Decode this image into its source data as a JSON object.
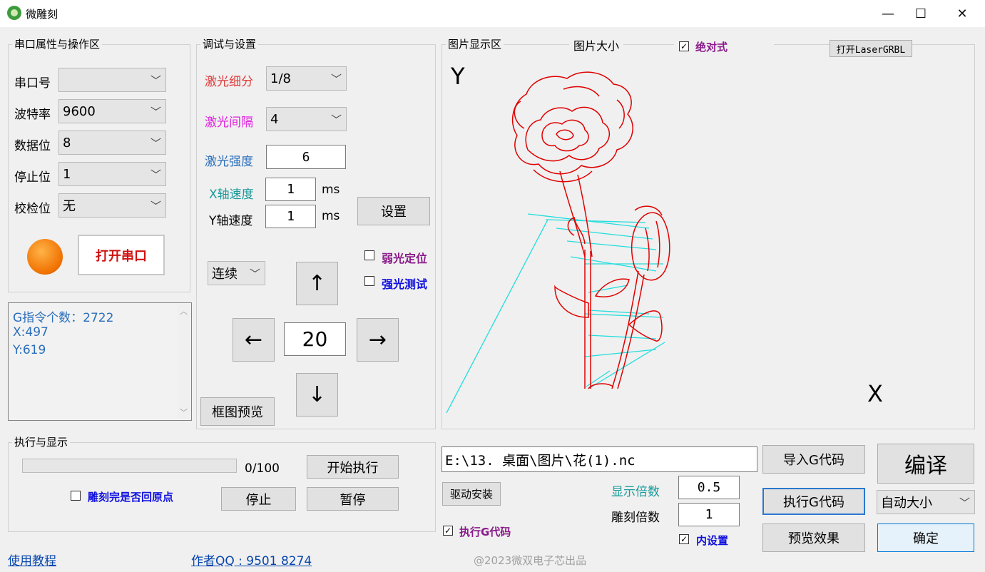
{
  "window": {
    "title": "微雕刻",
    "min": "—",
    "max": "☐",
    "close": "✕"
  },
  "serial": {
    "group": "串口属性与操作区",
    "port_label": "串口号",
    "port_value": "",
    "baud_label": "波特率",
    "baud_value": "9600",
    "data_label": "数据位",
    "data_value": "8",
    "stop_label": "停止位",
    "stop_value": "1",
    "parity_label": "校检位",
    "parity_value": "无",
    "open_button": "打开串口"
  },
  "info": {
    "line1": "G指令个数：2722",
    "line2": "X:497",
    "line3": "Y:619"
  },
  "debug": {
    "group": "调试与设置",
    "subdiv_label": "激光细分",
    "subdiv_value": "1/8",
    "interval_label": "激光间隔",
    "interval_value": "4",
    "power_label": "激光强度",
    "power_value": "6",
    "xspeed_label": "X轴速度",
    "xspeed_value": "1",
    "xspeed_unit": "ms",
    "yspeed_label": "Y轴速度",
    "yspeed_value": "1",
    "yspeed_unit": "ms",
    "set_button": "设置",
    "weak_label": "弱光定位",
    "strong_label": "强光测试",
    "mode_value": "连续",
    "step_value": "20",
    "up": "↑",
    "down": "↓",
    "left": "←",
    "right": "→",
    "frame_button": "框图预览"
  },
  "image": {
    "group": "图片显示区",
    "size_label": "图片大小",
    "absolute_label": "绝对式",
    "absolute_checked": "✓",
    "laser_button": "打开LaserGRBL",
    "y_axis": "Y",
    "x_axis": "X"
  },
  "exec": {
    "group": "执行与显示",
    "progress_text": "0/100",
    "progress": 0,
    "start_button": "开始执行",
    "stop_button": "停止",
    "pause_button": "暂停",
    "home_label": "雕刻完是否回原点"
  },
  "bottom": {
    "path_value": "E:\\13. 桌面\\图片\\花(1).nc",
    "import_button": "导入G代码",
    "compile_button": "编译",
    "driver_button": "驱动安装",
    "disp_scale_label": "显示倍数",
    "disp_scale_value": "0.5",
    "carve_scale_label": "雕刻倍数",
    "carve_scale_value": "1",
    "exec_gcode_button": "执行G代码",
    "autosize_value": "自动大小",
    "exec_gcode_check": "执行G代码",
    "exec_checked": "✓",
    "inner_set_check": "内设置",
    "inner_checked": "✓",
    "preview_button": "预览效果",
    "ok_button": "确定",
    "tutorial_link": "使用教程",
    "author_link": "作者QQ : 9501 8274",
    "watermark": "@2023微双电子芯出品"
  },
  "colors": {
    "red_label": "#e03a3a",
    "magenta_label": "#e020e0",
    "blue_label": "#2a6ebb",
    "teal_label": "#1a9a9a",
    "purple": "#8a1a8a",
    "bright_blue": "#1010e0",
    "rose": "#e00000",
    "cyan": "#22dddd"
  }
}
